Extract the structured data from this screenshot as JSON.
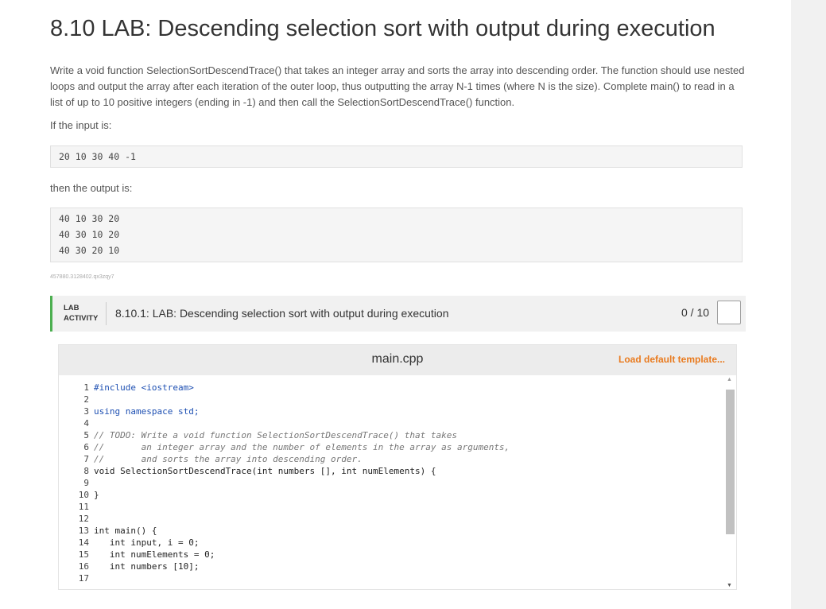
{
  "title": "8.10 LAB: Descending selection sort with output during execution",
  "description": "Write a void function SelectionSortDescendTrace() that takes an integer array and sorts the array into descending order. The function should use nested loops and output the array after each iteration of the outer loop, thus outputting the array N-1 times (where N is the size). Complete main() to read in a list of up to 10 positive integers (ending in -1) and then call the SelectionSortDescendTrace() function.",
  "input_label": "If the input is:",
  "input_lines": [
    "20 10 30 40 -1"
  ],
  "output_label": "then the output is:",
  "output_lines": [
    "40 10 30 20",
    "40 30 10 20",
    "40 30 20 10"
  ],
  "problem_id": "457880.3128402.qx3zqy7",
  "lab": {
    "tag_line1": "LAB",
    "tag_line2": "ACTIVITY",
    "title": "8.10.1: LAB: Descending selection sort with output during execution",
    "score": "0 / 10"
  },
  "editor": {
    "filename": "main.cpp",
    "load_default": "Load default template...",
    "line_numbers": [
      "1",
      "2",
      "3",
      "4",
      "5",
      "6",
      "7",
      "8",
      "9",
      "10",
      "11",
      "12",
      "13",
      "14",
      "15",
      "16",
      "17"
    ],
    "code_lines": [
      "#include <iostream>",
      "",
      "using namespace std;",
      "",
      "// TODO: Write a void function SelectionSortDescendTrace() that takes",
      "//       an integer array and the number of elements in the array as arguments,",
      "//       and sorts the array into descending order.",
      "void SelectionSortDescendTrace(int numbers [], int numElements) {",
      "",
      "}",
      "",
      "",
      "int main() {",
      "   int input, i = 0;",
      "   int numElements = 0;",
      "   int numbers [10];",
      ""
    ]
  },
  "icons": {
    "scroll_up": "up-arrow-icon",
    "scroll_down": "down-arrow-icon",
    "completion_box": "checkbox-icon"
  }
}
